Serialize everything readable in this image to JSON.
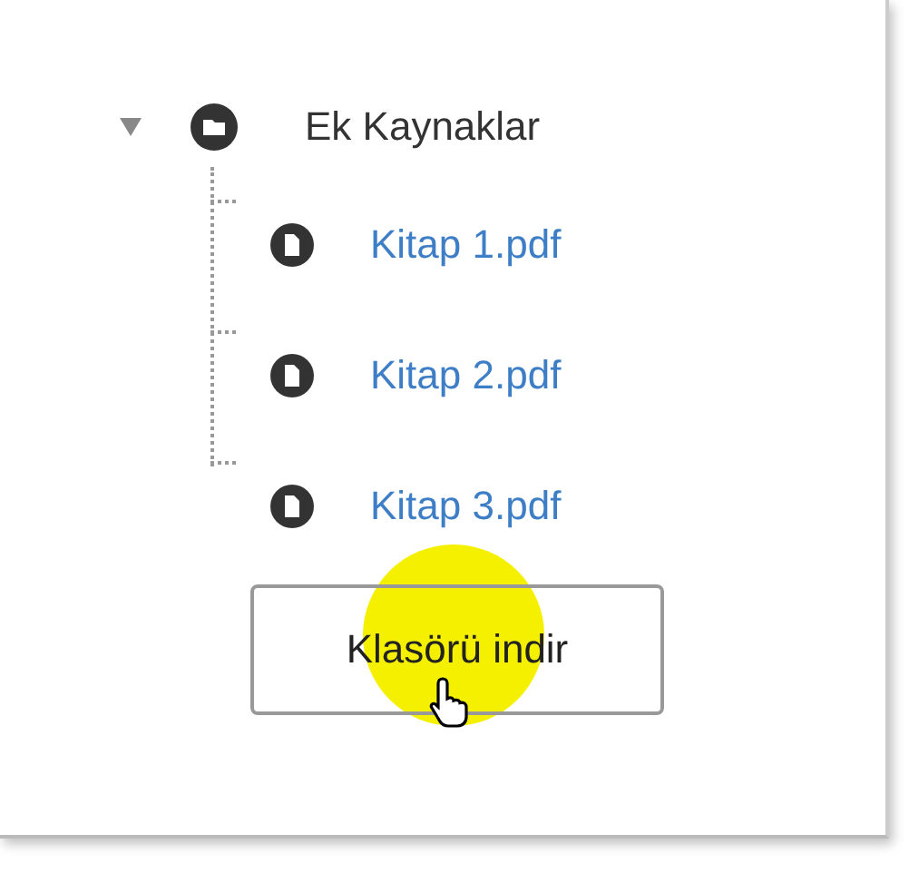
{
  "tree": {
    "label": "Ek Kaynaklar",
    "expanded": true,
    "children": [
      {
        "label": "Kitap 1.pdf"
      },
      {
        "label": "Kitap 2.pdf"
      },
      {
        "label": "Kitap 3.pdf"
      }
    ]
  },
  "button": {
    "label": "Klasörü indir"
  }
}
